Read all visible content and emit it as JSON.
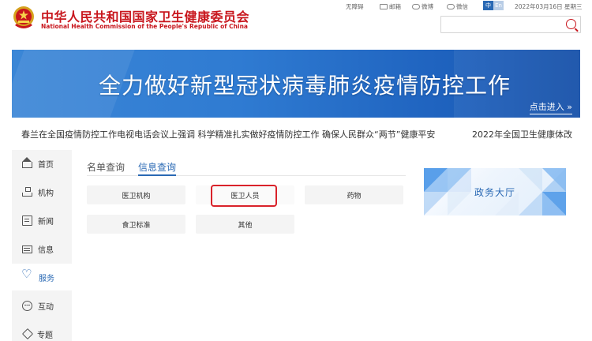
{
  "header": {
    "title_cn": "中华人民共和国国家卫生健康委员会",
    "title_en": "National Health Commission of the People's Republic of China",
    "links": {
      "accessibility": "无障碍",
      "mail": "邮箱",
      "weibo": "微博",
      "wechat": "微信"
    },
    "lang_zh": "中",
    "lang_en": "En",
    "date": "2022年03月16日 星期三",
    "search_placeholder": "",
    "brand_color": "#c8161d"
  },
  "banner": {
    "title": "全力做好新型冠状病毒肺炎疫情防控工作",
    "enter_label": "点击进入 »"
  },
  "ticker": {
    "item1": "春兰在全国疫情防控工作电视电话会议上强调 科学精准扎实做好疫情防控工作 确保人民群众“两节”健康平安",
    "item2": "2022年全国卫生健康体改"
  },
  "sidebar": {
    "items": [
      {
        "label": "首页",
        "icon": "home-icon"
      },
      {
        "label": "机构",
        "icon": "org-icon"
      },
      {
        "label": "新闻",
        "icon": "news-icon"
      },
      {
        "label": "信息",
        "icon": "info-icon"
      },
      {
        "label": "服务",
        "icon": "heart-icon",
        "active": true
      },
      {
        "label": "互动",
        "icon": "chat-icon"
      },
      {
        "label": "专题",
        "icon": "tag-icon"
      }
    ],
    "accent_color": "#2a69b4"
  },
  "main": {
    "tabs": [
      {
        "label": "名单查询"
      },
      {
        "label": "信息查询",
        "active": true
      }
    ],
    "buttons": [
      {
        "label": "医卫机构"
      },
      {
        "label": "医卫人员",
        "highlighted": true
      },
      {
        "label": "药物"
      },
      {
        "label": "食卫标准"
      },
      {
        "label": "其他"
      }
    ]
  },
  "gov_hall": {
    "label": "政务大厅"
  }
}
